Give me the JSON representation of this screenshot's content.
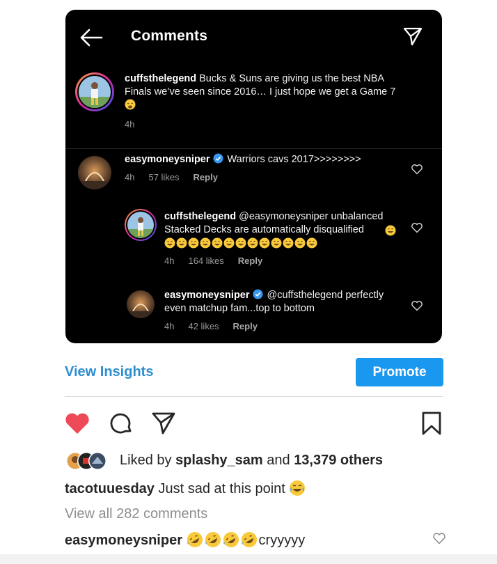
{
  "card": {
    "title": "Comments",
    "icons": {
      "back": "arrow-left-icon",
      "share": "paper-plane-icon"
    },
    "main_comment": {
      "username": "cuffsthelegend",
      "text": "Bucks & Suns are giving us the best NBA Finals we’ve seen since 2016… I just hope we get a Game 7",
      "emoji": "weary-face",
      "time": "4h"
    },
    "replies": [
      {
        "username": "easymoneysniper",
        "verified": true,
        "text": "Warriors cavs 2017>>>>>>>>",
        "time": "4h",
        "likes": "57 likes",
        "reply_label": "Reply"
      },
      {
        "username": "cuffsthelegend",
        "verified": false,
        "text_line1": "@easymoneysniper unbalanced",
        "text_line2": "Stacked Decks are automatically disqualified",
        "emoji": "grinning-sweat",
        "emoji_count": 13,
        "time": "4h",
        "likes": "164 likes",
        "reply_label": "Reply"
      },
      {
        "username": "easymoneysniper",
        "verified": true,
        "text_line1": "@cuffsthelegend perfectly",
        "text_line2": "even matchup fam...top to bottom",
        "time": "4h",
        "likes": "42 likes",
        "reply_label": "Reply"
      }
    ]
  },
  "insights": {
    "view_label": "View Insights",
    "promote_label": "Promote"
  },
  "actions": {
    "like_color": "#ed4956",
    "icons": [
      "heart-icon",
      "comment-icon",
      "share-icon",
      "bookmark-icon"
    ]
  },
  "likes": {
    "prefix": "Liked by ",
    "user": "splashy_sam",
    "middle": " and ",
    "count": "13,379 others"
  },
  "caption": {
    "username": "tacotuuesday",
    "text": "Just sad at this point"
  },
  "view_all": "View all 282 comments",
  "latest_comment": {
    "username": "easymoneysniper",
    "emoji": "rolling-on-floor-laughing",
    "emoji_count": 4,
    "text": "cryyyyy"
  },
  "colors": {
    "accent_blue": "#1a98ef",
    "link_blue": "#2b8ed0",
    "verified_blue": "#3897f0"
  }
}
